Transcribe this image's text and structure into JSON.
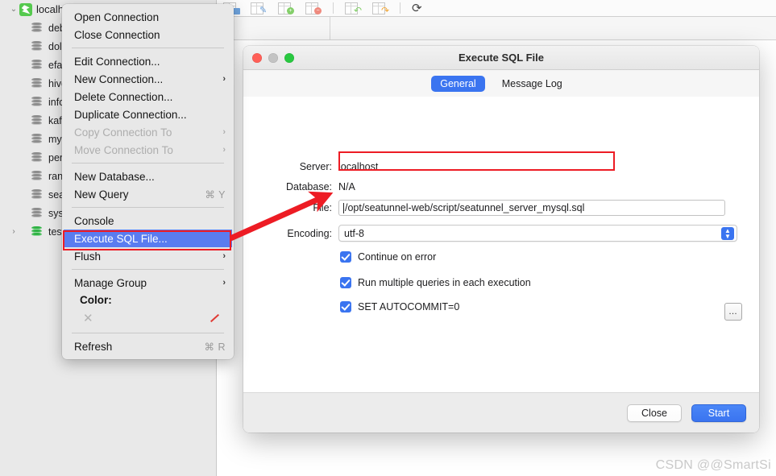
{
  "sidebar": {
    "root": {
      "label": "localhost",
      "icon": "sequel-host-icon",
      "disclosure": "⌄"
    },
    "items": [
      {
        "label": "debe",
        "icon": "database-icon"
      },
      {
        "label": "dolp",
        "icon": "database-icon"
      },
      {
        "label": "efak",
        "icon": "database-icon"
      },
      {
        "label": "hive_",
        "icon": "database-icon"
      },
      {
        "label": "infor",
        "icon": "database-icon"
      },
      {
        "label": "kafk",
        "icon": "database-icon"
      },
      {
        "label": "mys",
        "icon": "database-icon"
      },
      {
        "label": "perf",
        "icon": "database-icon"
      },
      {
        "label": "rang",
        "icon": "database-icon"
      },
      {
        "label": "seat",
        "icon": "database-icon"
      },
      {
        "label": "sys",
        "icon": "database-icon"
      },
      {
        "label": "test",
        "icon": "database-icon-active",
        "disclosure": "›"
      }
    ]
  },
  "toolbar": {
    "icons": [
      "table-open-icon",
      "table-edit-icon",
      "table-add-icon",
      "table-delete-icon",
      "table-undo-icon",
      "table-redo-icon",
      "refresh-icon"
    ],
    "refresh_glyph": "⟳"
  },
  "context_menu": {
    "items": [
      {
        "label": "Open Connection",
        "type": "item"
      },
      {
        "label": "Close Connection",
        "type": "item"
      },
      {
        "type": "separator"
      },
      {
        "label": "Edit Connection...",
        "type": "item"
      },
      {
        "label": "New Connection...",
        "type": "item",
        "submenu": "›"
      },
      {
        "label": "Delete Connection...",
        "type": "item"
      },
      {
        "label": "Duplicate Connection...",
        "type": "item"
      },
      {
        "label": "Copy Connection To",
        "type": "item",
        "submenu": "›",
        "disabled": true
      },
      {
        "label": "Move Connection To",
        "type": "item",
        "submenu": "›",
        "disabled": true
      },
      {
        "type": "separator"
      },
      {
        "label": "New Database...",
        "type": "item"
      },
      {
        "label": "New Query",
        "type": "item",
        "shortcut": "⌘ Y"
      },
      {
        "type": "separator"
      },
      {
        "label": "Console",
        "type": "item"
      },
      {
        "label": "Execute SQL File...",
        "type": "item",
        "selected": true
      },
      {
        "label": "Flush",
        "type": "item",
        "submenu": "›"
      },
      {
        "type": "separator"
      },
      {
        "label": "Manage Group",
        "type": "item",
        "submenu": "›"
      },
      {
        "label": "Color:",
        "type": "color-label"
      },
      {
        "type": "color-row",
        "none_glyph": "✕",
        "swatch": "#e03a33"
      },
      {
        "type": "separator"
      },
      {
        "label": "Refresh",
        "type": "item",
        "shortcut": "⌘ R"
      }
    ]
  },
  "dialog": {
    "title": "Execute SQL File",
    "traffic_lights": [
      "close-button",
      "minimize-button",
      "zoom-button"
    ],
    "tabs": [
      {
        "label": "General",
        "active": true
      },
      {
        "label": "Message Log",
        "active": false
      }
    ],
    "fields": {
      "server_label": "Server:",
      "server_value": "localhost",
      "database_label": "Database:",
      "database_value": "N/A",
      "file_label": "File:",
      "file_value": "/opt/seatunnel-web/script/seatunnel_server_mysql.sql",
      "browse_label": "…",
      "encoding_label": "Encoding:",
      "encoding_value": "utf-8"
    },
    "checkboxes": [
      {
        "label": "Continue on error",
        "checked": true
      },
      {
        "label": "Run multiple queries in each execution",
        "checked": true
      },
      {
        "label": "SET AUTOCOMMIT=0",
        "checked": true
      }
    ],
    "buttons": {
      "close": "Close",
      "start": "Start"
    }
  },
  "annotation": {
    "arrow_color": "#ed1c24",
    "highlight_color": "#ed1c24"
  },
  "watermark": "CSDN @@SmartSi",
  "colors": {
    "accent": "#3a74f0",
    "menu_selection": "#5a7cf0",
    "annotation_red": "#ed1c24",
    "sidebar_bg": "#e9e9e9",
    "menu_bg": "#e8e8e8"
  }
}
